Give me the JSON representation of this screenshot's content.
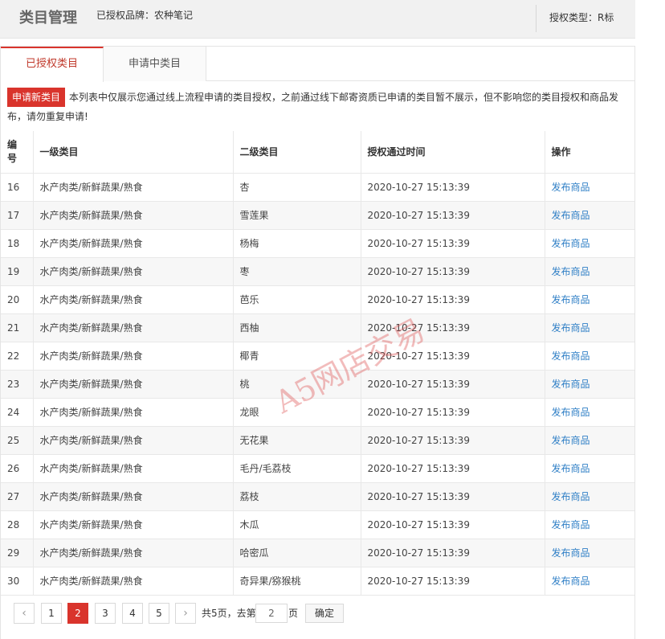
{
  "header": {
    "title": "类目管理",
    "brand_label": "已授权品牌：农种笔记",
    "auth_type_label": "授权类型：R标"
  },
  "tabs": [
    {
      "label": "已授权类目",
      "active": true
    },
    {
      "label": "申请中类目",
      "active": false
    }
  ],
  "notice": {
    "apply_button": "申请新类目",
    "text": "本列表中仅展示您通过线上流程申请的类目授权，之前通过线下邮寄资质已申请的类目暂不展示，但不影响您的类目授权和商品发布，请勿重复申请!"
  },
  "table": {
    "headers": {
      "id": "编号",
      "level1": "一级类目",
      "level2": "二级类目",
      "time": "授权通过时间",
      "op": "操作"
    },
    "rows": [
      {
        "id": "16",
        "level1": "水产肉类/新鲜蔬果/熟食",
        "level2": "杏",
        "time": "2020-10-27 15:13:39",
        "op": "发布商品"
      },
      {
        "id": "17",
        "level1": "水产肉类/新鲜蔬果/熟食",
        "level2": "雪莲果",
        "time": "2020-10-27 15:13:39",
        "op": "发布商品"
      },
      {
        "id": "18",
        "level1": "水产肉类/新鲜蔬果/熟食",
        "level2": "杨梅",
        "time": "2020-10-27 15:13:39",
        "op": "发布商品"
      },
      {
        "id": "19",
        "level1": "水产肉类/新鲜蔬果/熟食",
        "level2": "枣",
        "time": "2020-10-27 15:13:39",
        "op": "发布商品"
      },
      {
        "id": "20",
        "level1": "水产肉类/新鲜蔬果/熟食",
        "level2": "芭乐",
        "time": "2020-10-27 15:13:39",
        "op": "发布商品"
      },
      {
        "id": "21",
        "level1": "水产肉类/新鲜蔬果/熟食",
        "level2": "西柚",
        "time": "2020-10-27 15:13:39",
        "op": "发布商品"
      },
      {
        "id": "22",
        "level1": "水产肉类/新鲜蔬果/熟食",
        "level2": "椰青",
        "time": "2020-10-27 15:13:39",
        "op": "发布商品"
      },
      {
        "id": "23",
        "level1": "水产肉类/新鲜蔬果/熟食",
        "level2": "桃",
        "time": "2020-10-27 15:13:39",
        "op": "发布商品"
      },
      {
        "id": "24",
        "level1": "水产肉类/新鲜蔬果/熟食",
        "level2": "龙眼",
        "time": "2020-10-27 15:13:39",
        "op": "发布商品"
      },
      {
        "id": "25",
        "level1": "水产肉类/新鲜蔬果/熟食",
        "level2": "无花果",
        "time": "2020-10-27 15:13:39",
        "op": "发布商品"
      },
      {
        "id": "26",
        "level1": "水产肉类/新鲜蔬果/熟食",
        "level2": "毛丹/毛荔枝",
        "time": "2020-10-27 15:13:39",
        "op": "发布商品"
      },
      {
        "id": "27",
        "level1": "水产肉类/新鲜蔬果/熟食",
        "level2": "荔枝",
        "time": "2020-10-27 15:13:39",
        "op": "发布商品"
      },
      {
        "id": "28",
        "level1": "水产肉类/新鲜蔬果/熟食",
        "level2": "木瓜",
        "time": "2020-10-27 15:13:39",
        "op": "发布商品"
      },
      {
        "id": "29",
        "level1": "水产肉类/新鲜蔬果/熟食",
        "level2": "哈密瓜",
        "time": "2020-10-27 15:13:39",
        "op": "发布商品"
      },
      {
        "id": "30",
        "level1": "水产肉类/新鲜蔬果/熟食",
        "level2": "奇异果/猕猴桃",
        "time": "2020-10-27 15:13:39",
        "op": "发布商品"
      }
    ]
  },
  "watermark": "A5网店交易",
  "pagination": {
    "pages": [
      "1",
      "2",
      "3",
      "4",
      "5"
    ],
    "current": "2",
    "total_label": "共5页，去第",
    "page_suffix": "页",
    "goto_value": "2",
    "confirm_label": "确定"
  },
  "colors": {
    "accent": "#d9342c",
    "link": "#2f7fc6"
  }
}
